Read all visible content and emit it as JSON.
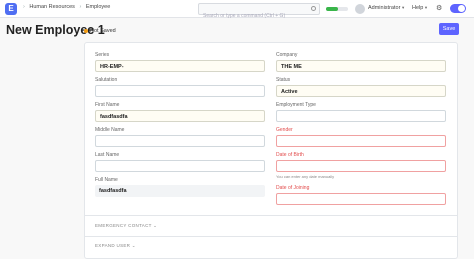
{
  "navbar": {
    "logo_letter": "E",
    "breadcrumbs": [
      "Human Resources",
      "Employee"
    ],
    "search_placeholder": "Search or type a command (Ctrl + G)",
    "progress": 0.55,
    "user_label": "Administrator",
    "help_label": "Help",
    "icons": [
      "search-icon",
      "gear-icon",
      "toggle",
      "chevron-down-icon"
    ]
  },
  "page": {
    "title": "New Employee 1",
    "status": "Not Saved",
    "save_label": "Save"
  },
  "form": {
    "left": [
      {
        "label": "Series",
        "value": "HR-EMP-"
      },
      {
        "label": "Salutation",
        "value": ""
      },
      {
        "label": "First Name",
        "value": "fasdfasdfa"
      },
      {
        "label": "Middle Name",
        "value": ""
      },
      {
        "label": "Last Name",
        "value": ""
      },
      {
        "label": "Full Name",
        "value": "fasdfasdfa"
      }
    ],
    "right": [
      {
        "label": "Company",
        "value": "THE ME"
      },
      {
        "label": "Status",
        "value": "Active"
      },
      {
        "label": "Employment Type",
        "value": ""
      },
      {
        "label": "Gender",
        "value": ""
      },
      {
        "label": "Date of Birth",
        "value": "",
        "hint": "You can enter any date manually"
      },
      {
        "label": "Date of Joining",
        "value": ""
      }
    ]
  },
  "sections": [
    "EMERGENCY CONTACT",
    "EXPAND USER"
  ],
  "colors": {
    "accent": "#5e64ff",
    "error": "#e24c4c",
    "status_dot": "#f39c12",
    "progress": "#39b54a"
  }
}
